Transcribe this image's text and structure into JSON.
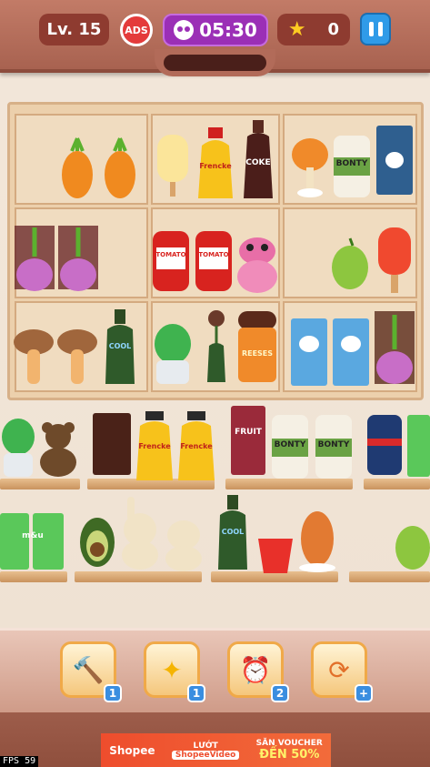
{
  "hud": {
    "level": "Lv. 15",
    "ads_label": "ADS",
    "timer": "05:30",
    "stars": "0"
  },
  "labels": {
    "frencke": "Frencke",
    "coke": "COKE",
    "bonty": "BONTY",
    "tomato": "TOMATO",
    "cool": "COOL",
    "reeses": "REESES",
    "fruit": "FRUIT",
    "m_u": "m&u"
  },
  "powerups": [
    {
      "name": "hammer",
      "count": "1"
    },
    {
      "name": "magic-wand",
      "count": "1"
    },
    {
      "name": "alarm-clock",
      "count": "2"
    },
    {
      "name": "shuffle",
      "count": "+"
    }
  ],
  "ad": {
    "brand": "Shopee",
    "luot": "LƯỚT",
    "video": "ShopeeVideo",
    "voucher": "SĂN VOUCHER",
    "discount": "ĐẾN 50%"
  },
  "fps": "FPS 59",
  "colors": {
    "topbar": "#a86250",
    "timer": "#9b2fb6",
    "pause": "#2f9be8",
    "shelf": "#ecd0ac"
  }
}
